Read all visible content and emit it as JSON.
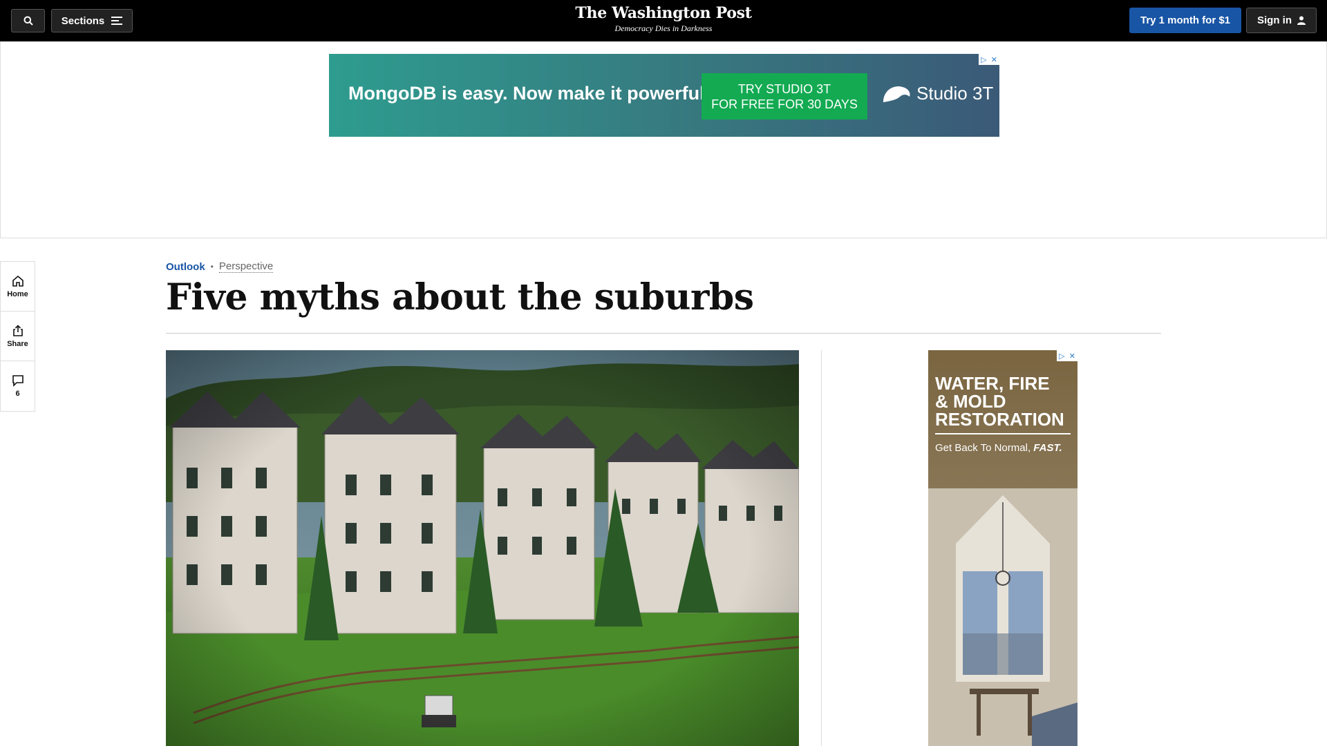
{
  "header": {
    "sections_label": "Sections",
    "logo_text": "The Washington Post",
    "tagline": "Democracy Dies in Darkness",
    "subscribe_label": "Try 1 month for $1",
    "signin_label": "Sign in"
  },
  "top_ad": {
    "headline": "MongoDB is easy. Now make it powerful.",
    "cta_line1": "TRY STUDIO 3T",
    "cta_line2": "FOR FREE FOR 30 DAYS",
    "brand": "Studio 3T"
  },
  "rail": {
    "home_label": "Home",
    "share_label": "Share",
    "comments_count": "6"
  },
  "article": {
    "section": "Outlook",
    "label": "Perspective",
    "title": "Five myths about the suburbs"
  },
  "side_ad": {
    "title_line1": "WATER, FIRE",
    "title_line2": "& MOLD",
    "title_line3": "RESTORATION",
    "sub_text": "Get Back To Normal,",
    "sub_emph": "FAST."
  },
  "colors": {
    "accent_blue": "#1955a5",
    "topbar_bg": "#000000",
    "ad_cta_green": "#13aa52"
  }
}
